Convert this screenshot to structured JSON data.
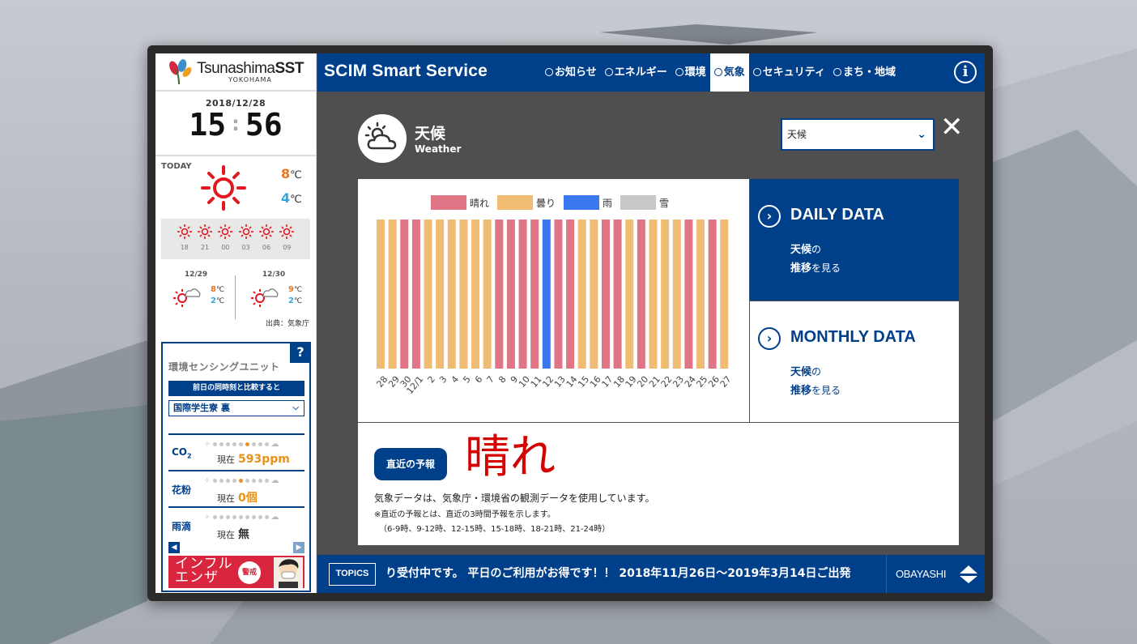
{
  "logo": {
    "brand": "TsunashimaSST",
    "brand_light": "Tsunashima",
    "brand_bold": "SST",
    "city": "YOKOHAMA"
  },
  "clock": {
    "date": "2018/12/28",
    "hour": "15",
    "separator": ":",
    "minute": "56"
  },
  "today": {
    "label": "TODAY",
    "icon": "sun-icon",
    "high": "8",
    "low": "4",
    "unit": "℃",
    "hourly": [
      {
        "hour": "18",
        "icon": "sun-icon"
      },
      {
        "hour": "21",
        "icon": "sun-icon"
      },
      {
        "hour": "00",
        "icon": "sun-icon"
      },
      {
        "hour": "03",
        "icon": "sun-icon"
      },
      {
        "hour": "06",
        "icon": "sun-icon"
      },
      {
        "hour": "09",
        "icon": "sun-icon"
      }
    ]
  },
  "forecast_days": [
    {
      "date": "12/29",
      "icon": "sun-cloud-icon",
      "high": "8",
      "low": "2"
    },
    {
      "date": "12/30",
      "icon": "sun-cloud-icon",
      "high": "9",
      "low": "2"
    }
  ],
  "source": "出典：気象庁",
  "sensor": {
    "title": "環境センシングユニット",
    "compare_label": "前日の同時刻と比較すると",
    "location": "国際学生寮 裏",
    "rows": [
      {
        "name": "CO",
        "sub": "2",
        "now_label": "現在",
        "value": "593ppm",
        "level": 5
      },
      {
        "name": "花粉",
        "sub": "",
        "now_label": "現在",
        "value": "0個",
        "level": 4
      },
      {
        "name": "雨滴",
        "sub": "",
        "now_label": "現在",
        "value": "無",
        "level": -1
      }
    ],
    "banner_text_1": "インフル",
    "banner_text_2": "エンザ",
    "banner_badge": "警戒"
  },
  "header": {
    "title": "SCIM Smart Service",
    "nav": [
      "お知らせ",
      "エネルギー",
      "環境",
      "気象",
      "セキュリティ",
      "まち・地域"
    ],
    "active": "気象"
  },
  "page": {
    "title": "天候",
    "subtitle": "Weather",
    "select_value": "天候"
  },
  "cards": {
    "daily": {
      "title": "DAILY DATA",
      "line1_bold": "天候",
      "line1": "の",
      "line2_bold": "推移",
      "line2": "を見る"
    },
    "monthly": {
      "title": "MONTHLY DATA",
      "line1_bold": "天候",
      "line1": "の",
      "line2_bold": "推移",
      "line2": "を見る"
    }
  },
  "latest": {
    "label": "直近の予報",
    "value": "晴れ",
    "note1": "気象データは、気象庁・環境省の観測データを使用しています。",
    "note2": "※直近の予報とは、直近の3時間予報を示します。",
    "note3": "（6-9時、9-12時、12-15時、15-18時、18-21時、21-24時）"
  },
  "topics": {
    "tag": "TOPICS",
    "text": "り受付中です。 平日のご利用がお得です！！ 2018年11月26日～2019年3月14日ご出発",
    "company": "OBAYASHI"
  },
  "colors": {
    "sunny": "#e07585",
    "cloudy": "#f0bc74",
    "rain": "#3b78f0",
    "snow": "#c8c8c8",
    "brand": "#003f8a"
  },
  "chart_data": {
    "type": "bar",
    "title": "",
    "legend": [
      {
        "name": "晴れ",
        "key": "sunny"
      },
      {
        "name": "曇り",
        "key": "cloudy"
      },
      {
        "name": "雨",
        "key": "rain"
      },
      {
        "name": "雪",
        "key": "snow"
      }
    ],
    "categories": [
      "28",
      "29",
      "30",
      "12/1",
      "2",
      "3",
      "4",
      "5",
      "6",
      "7",
      "8",
      "9",
      "10",
      "11",
      "12",
      "13",
      "14",
      "15",
      "16",
      "17",
      "18",
      "19",
      "20",
      "21",
      "22",
      "23",
      "24",
      "25",
      "26",
      "27"
    ],
    "weather": [
      "cloudy",
      "cloudy",
      "sunny",
      "sunny",
      "cloudy",
      "cloudy",
      "cloudy",
      "cloudy",
      "cloudy",
      "cloudy",
      "sunny",
      "sunny",
      "sunny",
      "sunny",
      "rain",
      "sunny",
      "sunny",
      "cloudy",
      "cloudy",
      "sunny",
      "sunny",
      "cloudy",
      "sunny",
      "cloudy",
      "cloudy",
      "cloudy",
      "sunny",
      "cloudy",
      "sunny",
      "cloudy"
    ],
    "values": [
      1,
      1,
      1,
      1,
      1,
      1,
      1,
      1,
      1,
      1,
      1,
      1,
      1,
      1,
      1,
      1,
      1,
      1,
      1,
      1,
      1,
      1,
      1,
      1,
      1,
      1,
      1,
      1,
      1,
      1
    ],
    "ylim": [
      0,
      1
    ]
  }
}
